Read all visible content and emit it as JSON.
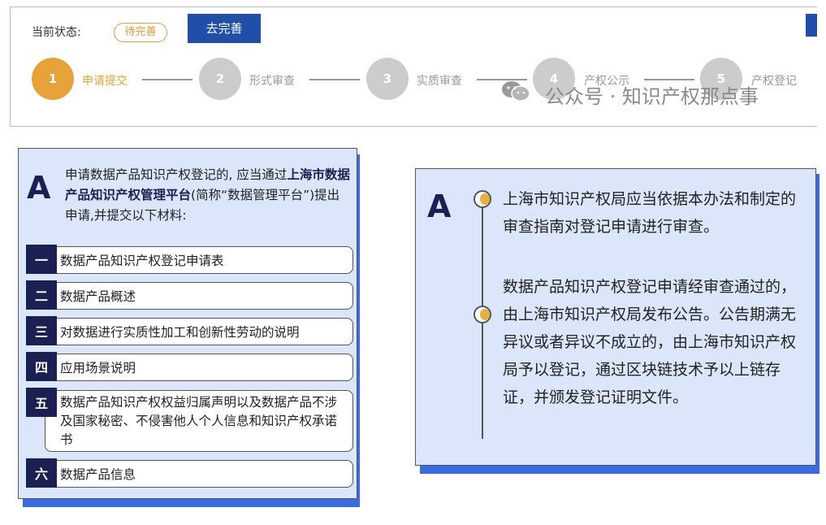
{
  "status": {
    "label": "当前状态:",
    "badge": "待完善",
    "action_button": "去完善"
  },
  "steps": [
    {
      "number": "1",
      "label": "申请提交",
      "active": true
    },
    {
      "number": "2",
      "label": "形式审查",
      "active": false
    },
    {
      "number": "3",
      "label": "实质审查",
      "active": false
    },
    {
      "number": "4",
      "label": "产权公示",
      "active": false
    },
    {
      "number": "5",
      "label": "产权登记",
      "active": false
    }
  ],
  "watermark": "公众号 · 知识产权那点事",
  "left": {
    "letter": "A",
    "intro_pre": "申请数据产品知识产权登记的, 应当通过",
    "intro_bold": "上海市数据产品知识产权管理平台",
    "intro_post": "(简称“数据管理平台”)提出申请,并提交以下材料:",
    "items": [
      {
        "num": "一",
        "text": "数据产品知识产权登记申请表"
      },
      {
        "num": "二",
        "text": "数据产品概述"
      },
      {
        "num": "三",
        "text": "对数据进行实质性加工和创新性劳动的说明"
      },
      {
        "num": "四",
        "text": "应用场景说明"
      },
      {
        "num": "五",
        "text": "数据产品知识产权权益归属声明以及数据产品不涉及国家秘密、不侵害他人个人信息和知识产权承诺书"
      },
      {
        "num": "六",
        "text": "数据产品信息"
      }
    ]
  },
  "right": {
    "letter": "A",
    "paragraph1": "上海市知识产权局应当依据本办法和制定的审查指南对登记申请进行审查。",
    "paragraph2": "数据产品知识产权登记申请经审查通过的，由上海市知识产权局发布公告。公告期满无异议或者异议不成立的，由上海市知识产权局予以登记，通过区块链技术予以上链存证，并颁发登记证明文件。"
  },
  "colors": {
    "accent_blue": "#1f4fa8",
    "active_step": "#e8a23a",
    "inactive_step": "#cccccc",
    "navy": "#1b1f52",
    "panel_bg": "#dbe6fb",
    "shadow_blue": "#3a6be0"
  }
}
